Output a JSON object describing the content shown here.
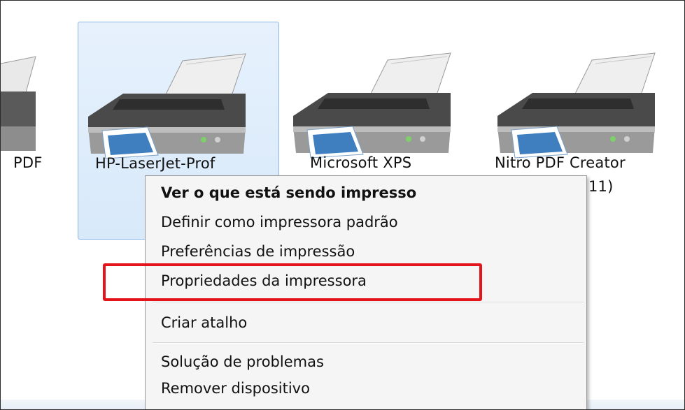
{
  "devices": [
    {
      "label": "PDF"
    },
    {
      "label": "HP-LaserJet-Prof"
    },
    {
      "label": "Microsoft XPS"
    },
    {
      "label": "Nitro PDF Creator"
    }
  ],
  "partial_label_under_menu": "11)",
  "context_menu": {
    "items": [
      {
        "label": "Ver o que está sendo impresso",
        "bold": true
      },
      {
        "label": "Definir como impressora padrão"
      },
      {
        "label": "Preferências de impressão"
      },
      {
        "label": "Propriedades da impressora",
        "highlighted": true
      },
      {
        "label": "Criar atalho"
      },
      {
        "label": "Solução de problemas"
      },
      {
        "label": "Remover dispositivo"
      }
    ]
  },
  "colors": {
    "selection_bg": "#dbeafa",
    "selection_border": "#90b7e2",
    "highlight_box": "#e4151a",
    "menu_bg": "#f5f5f5"
  },
  "icons": [
    "printer-icon"
  ]
}
